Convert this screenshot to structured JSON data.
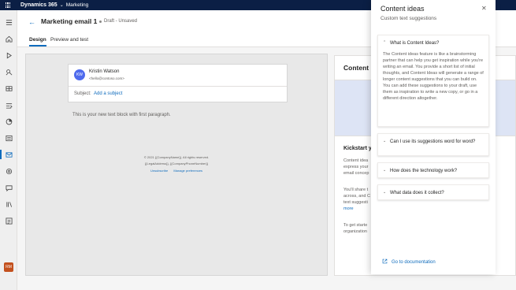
{
  "topbar": {
    "app_name": "Dynamics 365",
    "chevron": "⌄",
    "area": "Marketing"
  },
  "rail": {
    "items": [
      {
        "name": "menu-icon"
      },
      {
        "name": "home-icon"
      },
      {
        "name": "play-icon"
      },
      {
        "name": "pin-icon"
      },
      {
        "name": "segments-icon"
      },
      {
        "name": "calendar-icon"
      },
      {
        "name": "list-icon"
      },
      {
        "name": "insights-icon"
      },
      {
        "name": "contacts-icon"
      },
      {
        "name": "email-icon",
        "active": true
      },
      {
        "name": "forms-icon"
      },
      {
        "name": "chat-icon"
      },
      {
        "name": "library-icon"
      },
      {
        "name": "templates-icon"
      }
    ],
    "user_initials": "RM"
  },
  "header": {
    "title": "Marketing email 1",
    "status": "Draft - Unsaved"
  },
  "tabs": [
    {
      "label": "Design",
      "active": true
    },
    {
      "label": "Preview and test",
      "active": false
    }
  ],
  "email": {
    "avatar_initials": "KW",
    "sender_name": "Kristin Watson",
    "sender_email": "<hello@contoso.com>",
    "subject_label": "Subject:",
    "subject_link": "Add a subject",
    "body_text": "This is your new text block with first paragraph.",
    "footer_line1": "© 2021 {{CompanyName}}. All rights reserved.",
    "footer_line2": "{{LegalAddress}}, {{CompanyPhoneNumber}}",
    "footer_unsubscribe": "Unsubscribe",
    "footer_preferences": "Manage preferences"
  },
  "side_page": {
    "title": "Content",
    "kickstart": "Kickstart y",
    "para1": [
      "Content idea",
      "express your",
      "email concep"
    ],
    "para2": [
      "You'll share t",
      "across, and C",
      "text suggesti"
    ],
    "more": "more",
    "para3": [
      "To get starte",
      "organization"
    ]
  },
  "panel": {
    "title": "Content ideas",
    "subtitle": "Custom text suggestions",
    "close": "✕",
    "accordions": [
      {
        "label": "What is Content Ideas?",
        "expanded": true,
        "body": "The Content ideas feature is like a brainstorming partner that can help you get inspiration while you're writing an email. You provide a short list of initial thoughts, and Content Ideas will generate a range of longer content suggestions that you can build on. You can add these suggestions to your draft, use them as inspiration to write a new copy, or go in a different direction altogether."
      },
      {
        "label": "Can I use its suggestions word for word?",
        "expanded": false
      },
      {
        "label": "How does the technology work?",
        "expanded": false
      },
      {
        "label": "What data does it collect?",
        "expanded": false
      }
    ],
    "doc_link": "Go to documentation"
  },
  "colors": {
    "topbar": "#0b1f45",
    "accent": "#0f6cbd",
    "avatar_kw": "#4f6bed",
    "avatar_rm": "#c3501d"
  }
}
